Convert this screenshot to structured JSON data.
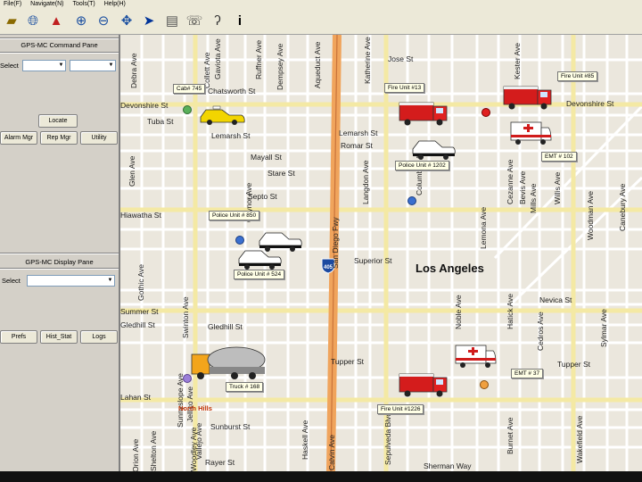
{
  "menu": [
    "File(F)",
    "Navigate(N)",
    "Tools(T)",
    "Help(H)"
  ],
  "toolbar_icons": [
    "folder-icon",
    "globe-icon",
    "hat-icon",
    "zoom-in-icon",
    "zoom-out-icon",
    "pan-icon",
    "select-arrow-icon",
    "radio-icon",
    "phone-icon",
    "ear-icon",
    "info-icon"
  ],
  "command_pane": {
    "title": "GPS-MC Command Pane",
    "select_label": "Select",
    "buttons": {
      "locate": "Locate",
      "alarm": "Alarm Mgr",
      "rep": "Rep Mgr",
      "utility": "Utility"
    }
  },
  "display_pane": {
    "title": "GPS-MC Display Pane",
    "select_label": "Select",
    "buttons": {
      "prefs": "Prefs",
      "hist": "Hist_Stat",
      "logs": "Logs"
    }
  },
  "map": {
    "city_label": "Los Angeles",
    "neighborhood": "North Hills",
    "freeway_shield": "405",
    "streets_h": [
      "Jose St",
      "Chatsworth St",
      "Tuba St",
      "Lemarsh St",
      "Mayall St",
      "Stare St",
      "Septo St",
      "Superior St",
      "Nevica St",
      "Tupper St",
      "Gledhill St",
      "Sunburst St",
      "Rayer St",
      "Devonshire St",
      "Romar St",
      "Lemarsh St",
      "Devonshire St",
      "Summer St",
      "Lahan St",
      "Gledhill St",
      "Hiawatha St",
      "Tupper St",
      "Sherman Way"
    ],
    "streets_v": [
      "Debra Ave",
      "Collett Ave",
      "Gaviota Ave",
      "Ruffner Ave",
      "Dempsey Ave",
      "Aqueduct Ave",
      "San Diego Fwy",
      "Haskell Ave",
      "Sepulveda Blvd",
      "Columbus Ave",
      "Noble Ave",
      "Kester Ave",
      "Katherine Ave",
      "Langdon Ave",
      "Lemona Ave",
      "Hatick Ave",
      "Cedros Ave",
      "Sylmar Ave",
      "Cezanne Ave",
      "Woodman Ave",
      "Canebury Ave",
      "Willis Ave",
      "Mills Ave",
      "Bevis Ave",
      "Burnet Ave",
      "Wakefield Ave",
      "Swinton Ave",
      "Gaynor Ave",
      "Sunnyslope Ave",
      "Jellico Ave",
      "Vallejo Ave",
      "Woodley Ave",
      "Shelton Ave",
      "Orion Ave",
      "Gothic Ave",
      "Glen Ave",
      "Calvin Ave"
    ],
    "units": [
      {
        "label": "Cab# 745",
        "type": "taxi"
      },
      {
        "label": "Fire Unit #13",
        "type": "fire"
      },
      {
        "label": "Fire Unit #85",
        "type": "fire"
      },
      {
        "label": "Police Unit # 1202",
        "type": "police"
      },
      {
        "label": "EMT # 102",
        "type": "emt"
      },
      {
        "label": "Police Unit # 850",
        "type": "police"
      },
      {
        "label": "Police Unit # 524",
        "type": "police"
      },
      {
        "label": "EMT # 37",
        "type": "emt"
      },
      {
        "label": "Fire Unit #1226",
        "type": "fire"
      },
      {
        "label": "Truck # 168",
        "type": "truck"
      }
    ]
  },
  "colors": {
    "freeway": "#f0a45c",
    "arterial": "#f4e9a4",
    "street": "#ffffff",
    "map_bg": "#ebe7dd",
    "panel": "#d4d0c8"
  }
}
